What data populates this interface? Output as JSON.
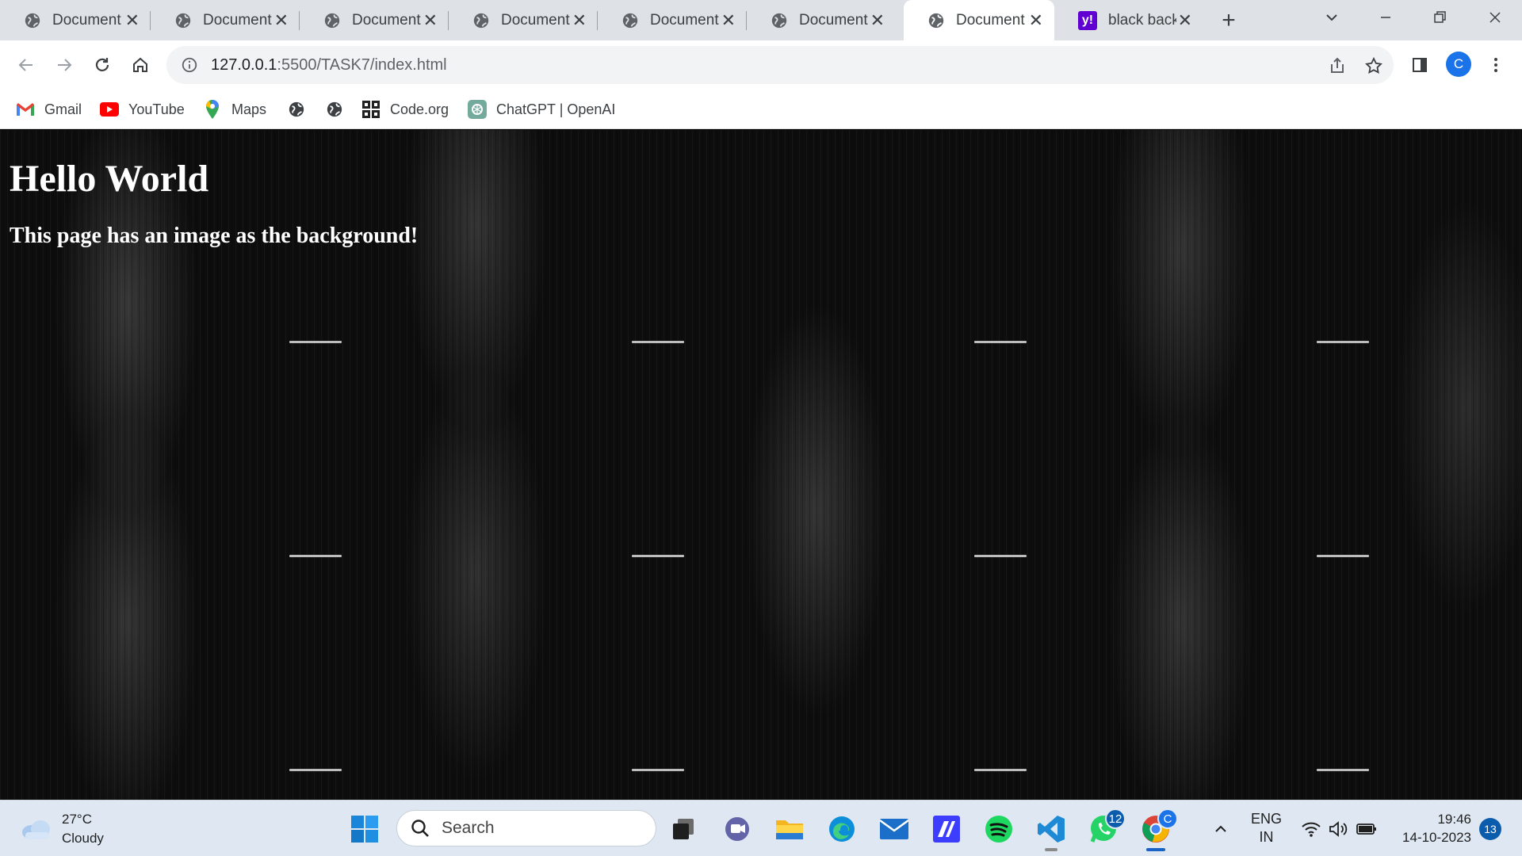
{
  "browser": {
    "tabs": [
      {
        "label": "Document",
        "icon": "globe-icon"
      },
      {
        "label": "Document",
        "icon": "globe-icon"
      },
      {
        "label": "Document",
        "icon": "globe-icon"
      },
      {
        "label": "Document",
        "icon": "globe-icon"
      },
      {
        "label": "Document",
        "icon": "globe-icon"
      },
      {
        "label": "Document",
        "icon": "globe-icon"
      },
      {
        "label": "Document",
        "icon": "globe-icon",
        "active": true
      },
      {
        "label": "black back",
        "icon": "yahoo-icon"
      }
    ],
    "close_glyph": "✕",
    "new_tab_glyph": "+",
    "yahoo_glyph": "y!",
    "url_host": "127.0.0.1",
    "url_path": ":5500/TASK7/index.html",
    "profile_initial": "C",
    "bookmarks": [
      {
        "label": "Gmail",
        "icon": "gmail-icon"
      },
      {
        "label": "YouTube",
        "icon": "youtube-icon"
      },
      {
        "label": "Maps",
        "icon": "maps-icon"
      },
      {
        "label": "",
        "icon": "globe-icon"
      },
      {
        "label": "",
        "icon": "globe-icon"
      },
      {
        "label": "Code.org",
        "icon": "codeorg-icon"
      },
      {
        "label": "ChatGPT | OpenAI",
        "icon": "chatgpt-icon"
      }
    ]
  },
  "page": {
    "heading": "Hello World",
    "subheading": "This page has an image as the background!"
  },
  "taskbar": {
    "weather_temp": "27°C",
    "weather_desc": "Cloudy",
    "search_label": "Search",
    "whatsapp_badge": "12",
    "chrome_badge": "C",
    "lang_line1": "ENG",
    "lang_line2": "IN",
    "time": "19:46",
    "date": "14-10-2023",
    "notifications": "13"
  },
  "colors": {
    "tabstrip": "#dee1e6",
    "accent": "#1a73e8",
    "taskbar": "#dfe8f2"
  }
}
